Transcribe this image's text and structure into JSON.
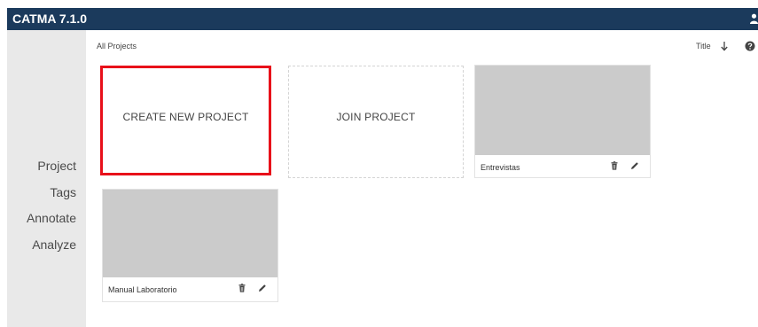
{
  "app": {
    "title": "CATMA 7.1.0"
  },
  "sidebar": {
    "items": [
      "Project",
      "Tags",
      "Annotate",
      "Analyze"
    ]
  },
  "toolbar": {
    "breadcrumb": "All Projects",
    "sort_label": "Title"
  },
  "cards": {
    "create_label": "CREATE NEW PROJECT",
    "join_label": "JOIN PROJECT"
  },
  "projects": [
    {
      "name": "Entrevistas"
    },
    {
      "name": "Manual Laboratorio"
    }
  ],
  "icons": {
    "user": "user-icon",
    "sort": "arrow-down-icon",
    "help": "help-circle-icon",
    "delete": "trash-icon",
    "edit": "pencil-icon"
  },
  "colors": {
    "header": "#1b3a5c",
    "highlight": "#e8101a",
    "thumbnail": "#cbcbcb",
    "sidebar": "#e9e9e9"
  }
}
